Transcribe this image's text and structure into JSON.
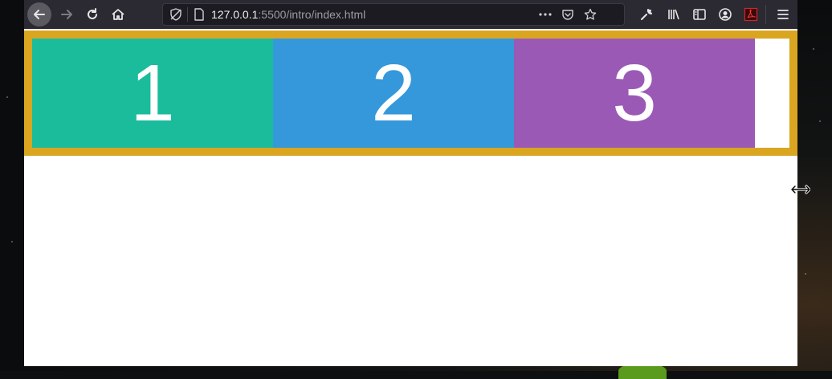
{
  "browser": {
    "url_host": "127.0.0.1",
    "url_path": ":5500/intro/index.html"
  },
  "page": {
    "container_color": "#daa520",
    "boxes": [
      {
        "label": "1",
        "color": "#1abc9c"
      },
      {
        "label": "2",
        "color": "#3498db"
      },
      {
        "label": "3",
        "color": "#9b59b6"
      }
    ]
  },
  "icons": {
    "back": "arrow-left-icon",
    "forward": "arrow-right-icon",
    "reload": "reload-icon",
    "home": "home-icon",
    "tracking": "tracking-protection-icon",
    "page": "page-icon",
    "more": "more-icon",
    "pocket": "pocket-icon",
    "bookmark": "star-icon",
    "devtools": "wrench-icon",
    "library": "library-icon",
    "sidebar": "sidebar-icon",
    "account": "account-icon",
    "pdf": "pdf-icon",
    "menu": "hamburger-menu-icon",
    "cursor": "resize-horizontal-cursor-icon"
  }
}
